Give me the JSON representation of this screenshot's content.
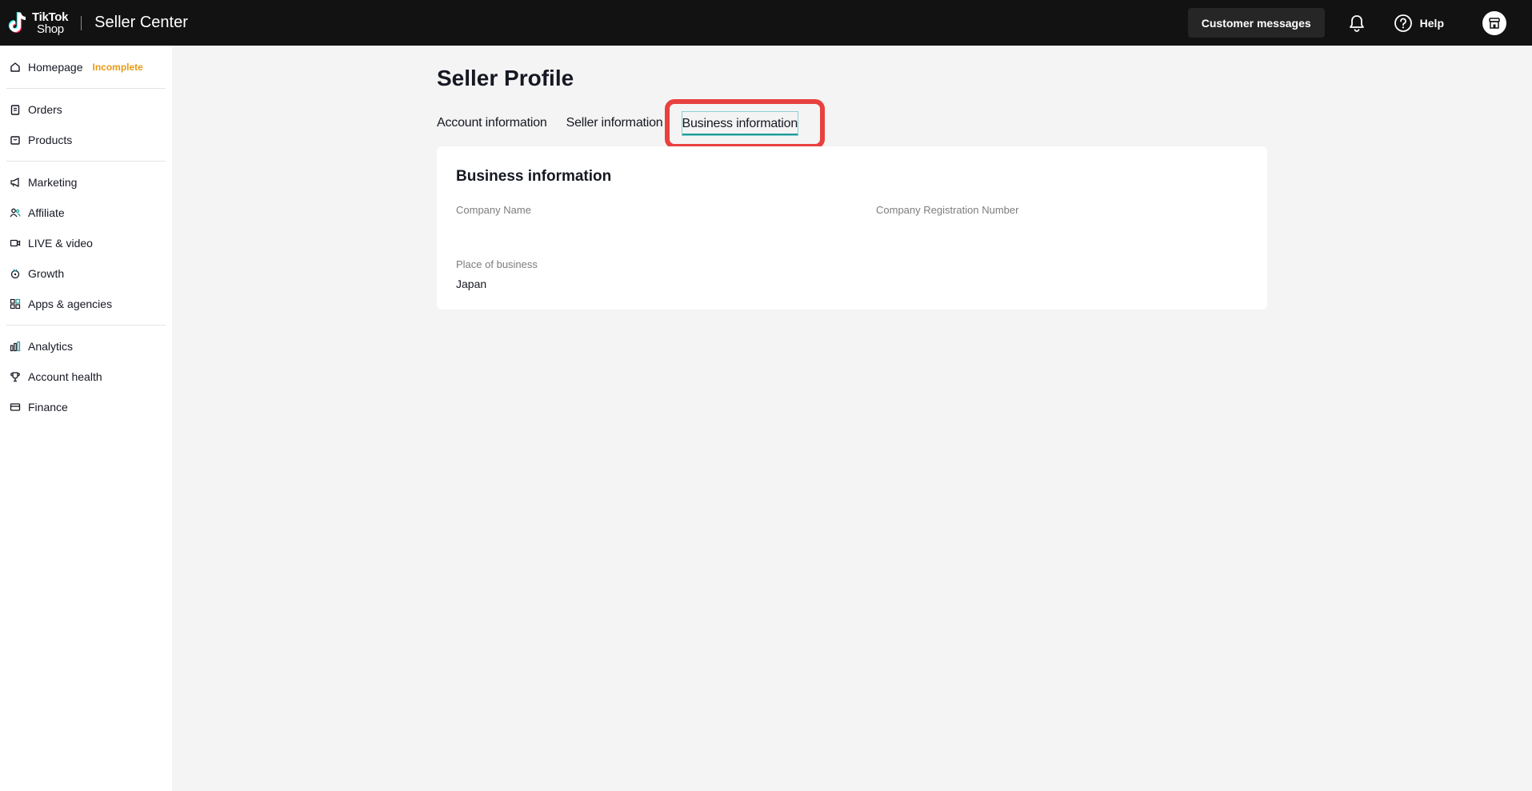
{
  "header": {
    "logo_line1": "TikTok",
    "logo_line2": "Shop",
    "app_title": "Seller Center",
    "customer_messages_label": "Customer messages",
    "help_label": "Help"
  },
  "sidebar": {
    "items": [
      {
        "label": "Homepage",
        "badge": "Incomplete",
        "icon": "home-icon"
      },
      {
        "label": "Orders",
        "icon": "clipboard-icon"
      },
      {
        "label": "Products",
        "icon": "bag-icon"
      },
      {
        "label": "Marketing",
        "icon": "megaphone-icon"
      },
      {
        "label": "Affiliate",
        "icon": "people-icon"
      },
      {
        "label": "LIVE & video",
        "icon": "video-icon"
      },
      {
        "label": "Growth",
        "icon": "growth-icon"
      },
      {
        "label": "Apps & agencies",
        "icon": "apps-icon"
      },
      {
        "label": "Analytics",
        "icon": "bar-chart-icon"
      },
      {
        "label": "Account health",
        "icon": "trophy-icon"
      },
      {
        "label": "Finance",
        "icon": "card-icon"
      }
    ]
  },
  "main": {
    "page_title": "Seller Profile",
    "tabs": [
      {
        "label": "Account information"
      },
      {
        "label": "Seller information"
      },
      {
        "label": "Business information",
        "active": true
      }
    ],
    "card": {
      "title": "Business information",
      "fields": [
        {
          "label": "Company Name",
          "value": ""
        },
        {
          "label": "Company Registration Number",
          "value": ""
        },
        {
          "label": "Place of business",
          "value": "Japan"
        }
      ]
    }
  },
  "colors": {
    "topbar_bg": "#121212",
    "badge_orange": "#e89a14",
    "highlight_red": "#e8413f",
    "tab_underline": "#1c9a9a"
  }
}
